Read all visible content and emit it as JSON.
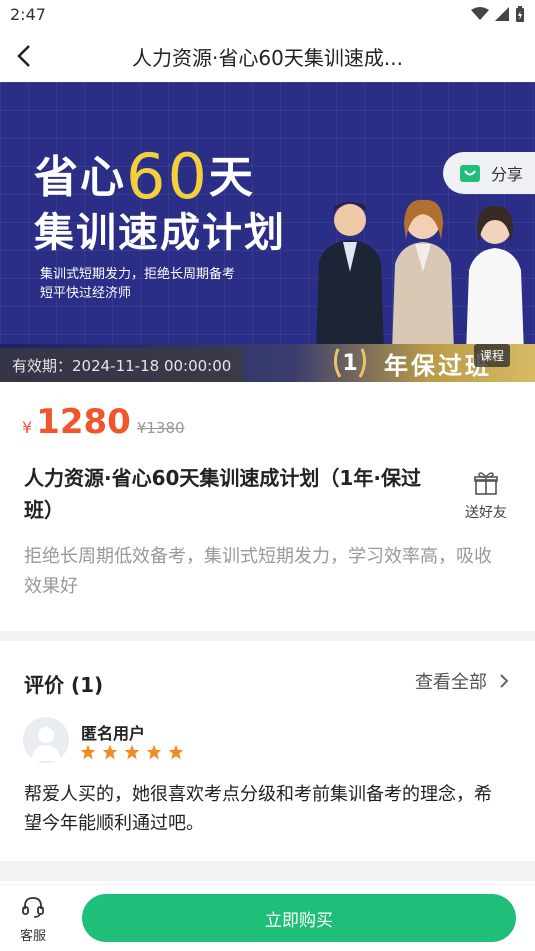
{
  "status_bar": {
    "time": "2:47"
  },
  "nav": {
    "title": "人力资源·省心60天集训速成..."
  },
  "banner": {
    "title_pre": "省心",
    "title_num": "60",
    "title_post": "天",
    "title_line2": "集训速成计划",
    "subtitle_line1": "集训式短期发力，拒绝长周期备考",
    "subtitle_line2": "短平快过经济师",
    "share_label": "分享",
    "validity": "有效期：2024-11-18 00:00:00",
    "year_num": "1",
    "year_text": "年保过班",
    "course_tag": "课程"
  },
  "price": {
    "symbol": "¥",
    "current": "1280",
    "original": "¥1380"
  },
  "course": {
    "title": "人力资源·省心60天集训速成计划（1年·保过班）",
    "description": "拒绝长周期低效备考，集训式短期发力，学习效率高，吸收效果好",
    "gift_label": "送好友"
  },
  "reviews": {
    "title": "评价 (1)",
    "view_all": "查看全部",
    "items": [
      {
        "user": "匿名用户",
        "rating": 5,
        "text": "帮爱人买的，她很喜欢考点分级和考前集训备考的理念，希望今年能顺利通过吧。"
      }
    ]
  },
  "bottom": {
    "service_label": "客服",
    "buy_label": "立即购买"
  },
  "colors": {
    "accent": "#1fbf7a",
    "price": "#f0552c",
    "banner_bg": "#2b2e86",
    "star": "#f58a23"
  }
}
